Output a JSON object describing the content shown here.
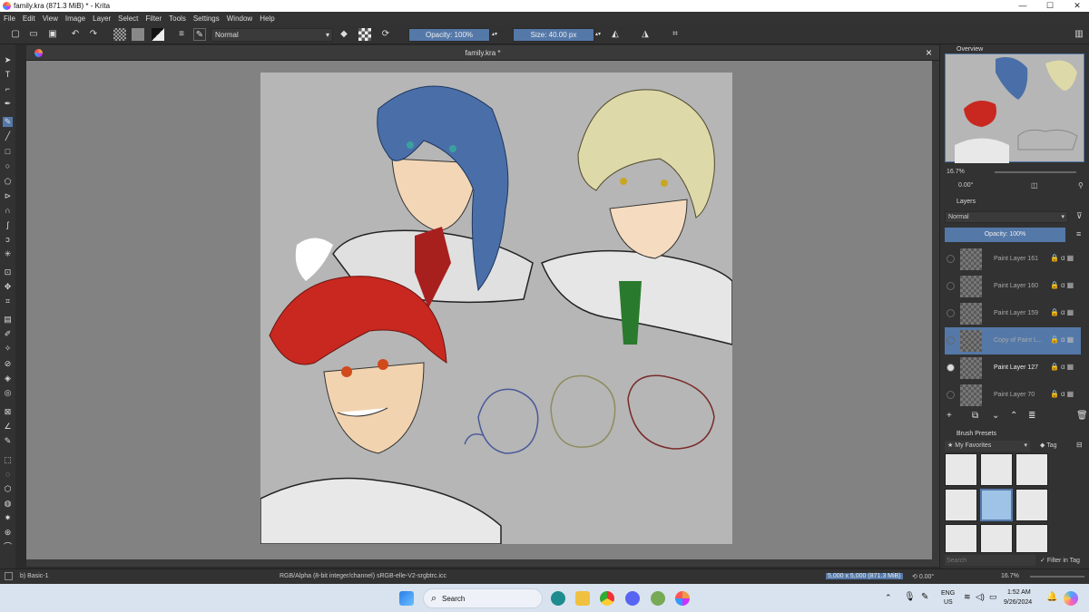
{
  "window": {
    "title": "family.kra (871.3 MiB)  * - Krita",
    "minimize": "—",
    "maximize": "☐",
    "close": "✕"
  },
  "menu": [
    "File",
    "Edit",
    "View",
    "Image",
    "Layer",
    "Select",
    "Filter",
    "Tools",
    "Settings",
    "Window",
    "Help"
  ],
  "toolbar": {
    "blend_mode": "Normal",
    "opacity": "Opacity: 100%",
    "size": "Size: 40.00 px"
  },
  "document": {
    "tab_title": "family.kra *"
  },
  "overview": {
    "title": "Overview",
    "zoom": "16.7%",
    "rotation": "0.00°"
  },
  "layers": {
    "title": "Layers",
    "blend_mode": "Normal",
    "opacity": "Opacity:  100%",
    "items": [
      {
        "name": "Paint Layer 161",
        "visible": false,
        "selected": false
      },
      {
        "name": "Paint Layer 160",
        "visible": false,
        "selected": false
      },
      {
        "name": "Paint Layer 159",
        "visible": false,
        "selected": false
      },
      {
        "name": "Copy of Paint L...",
        "visible": false,
        "selected": true
      },
      {
        "name": "Paint Layer 127",
        "visible": true,
        "selected": false
      },
      {
        "name": "Paint Layer 70",
        "visible": false,
        "selected": false
      }
    ]
  },
  "brush_presets": {
    "title": "Brush Presets",
    "tag_filter": "My Favorites",
    "tag_button": "Tag",
    "search_placeholder": "Search",
    "filter_in_tag": "Filter in Tag"
  },
  "status": {
    "brush": "b) Basic-1",
    "color_space": "RGB/Alpha (8-bit integer/channel)  sRGB-elle-V2-srgbtrc.icc",
    "image_size": "5,000 x 5,000 (871.3 MiB)",
    "rotation": "0.00°",
    "zoom": "16.7%"
  },
  "taskbar": {
    "search": "Search",
    "lang_top": "ENG",
    "lang_bottom": "US",
    "time": "1:52 AM",
    "date": "9/26/2024"
  },
  "colors": {
    "accent": "#5478a8",
    "canvas_bg": "#828282",
    "panel": "#323232"
  }
}
